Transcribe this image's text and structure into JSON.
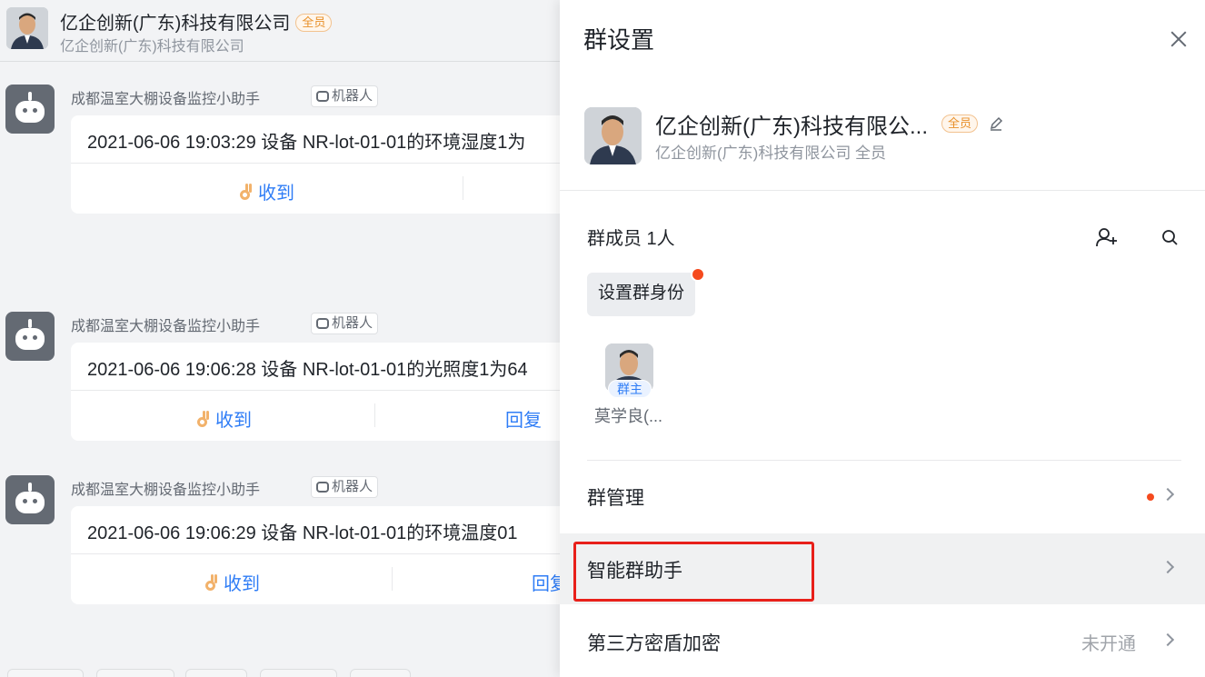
{
  "chat": {
    "title": "亿企创新(广东)科技有限公司",
    "badge": "全员",
    "subtitle": "亿企创新(广东)科技有限公司",
    "messages": [
      {
        "sender": "成都温室大棚设备监控小助手",
        "tag": "机器人",
        "text": "2021-06-06 19:03:29 设备 NR-lot-01-01的环境湿度1为",
        "ack": "收到",
        "reply": ""
      },
      {
        "sender": "成都温室大棚设备监控小助手",
        "tag": "机器人",
        "text": "2021-06-06 19:06:28 设备 NR-lot-01-01的光照度1为64",
        "ack": "收到",
        "reply": "回复"
      },
      {
        "sender": "成都温室大棚设备监控小助手",
        "tag": "机器人",
        "text": "2021-06-06 19:06:29 设备 NR-lot-01-01的环境温度01",
        "ack": "收到",
        "reply": "回复"
      }
    ]
  },
  "panel": {
    "title": "群设置",
    "group_name": "亿企创新(广东)科技有限公...",
    "group_badge": "全员",
    "group_sub": "亿企创新(广东)科技有限公司  全员",
    "members_title": "群成员 1人",
    "set_identity": "设置群身份",
    "member": {
      "role": "群主",
      "name": "莫学良(..."
    },
    "rows": [
      {
        "label": "群管理",
        "value": ""
      },
      {
        "label": "智能群助手",
        "value": ""
      },
      {
        "label": "第三方密盾加密",
        "value": "未开通"
      }
    ]
  },
  "colors": {
    "accent": "#2f7df6",
    "alert": "#f54a1e",
    "highlight": "#e8201a"
  },
  "icons": [
    "close-icon",
    "edit-icon",
    "add-member-icon",
    "search-icon",
    "chevron-icon",
    "robot-icon",
    "ok-hand-icon"
  ]
}
